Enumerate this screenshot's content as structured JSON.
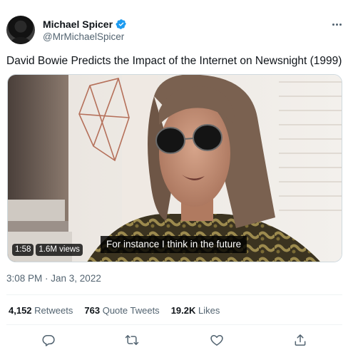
{
  "author": {
    "display_name": "Michael Spicer",
    "handle": "@MrMichaelSpicer",
    "verified": true
  },
  "tweet": {
    "text": "David Bowie Predicts the Impact of the Internet on Newsnight (1999)",
    "timestamp": "3:08 PM · Jan 3, 2022"
  },
  "media": {
    "type": "video",
    "subtitle": "For instance I think in the future",
    "duration": "1:58",
    "views": "1.6M views"
  },
  "stats": {
    "retweets_count": "4,152",
    "retweets_label": "Retweets",
    "quote_tweets_count": "763",
    "quote_tweets_label": "Quote Tweets",
    "likes_count": "19.2K",
    "likes_label": "Likes"
  },
  "actions": {
    "icons": [
      "reply-icon",
      "retweet-icon",
      "like-icon",
      "share-icon"
    ]
  },
  "colors": {
    "primary_text": "#0f1419",
    "secondary_text": "#536471",
    "verified_blue": "#1d9bf0",
    "divider": "#eff3f4"
  }
}
